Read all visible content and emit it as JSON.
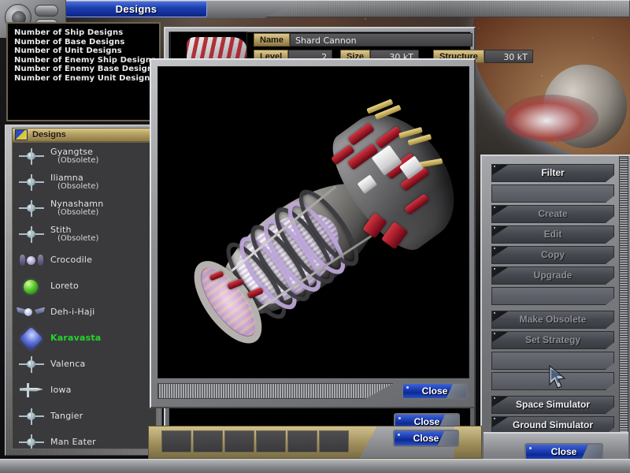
{
  "window": {
    "tab_label": "Designs",
    "icons": {
      "main_knob": "system-menu-icon",
      "pill_1": "minimize-icon",
      "pill_2": "maximize-icon"
    }
  },
  "left_readout": {
    "lines": [
      "Number of Ship Designs",
      "Number of Base Designs",
      "Number of Unit Designs",
      "Number of Enemy Ship Designs",
      "Number of Enemy Base Designs",
      "Number of Enemy Unit Designs"
    ]
  },
  "designs_panel": {
    "header_label": "Designs",
    "header_icon": "shield-flag-icon",
    "scroll_down_icon": "chevron-down-icon",
    "items": [
      {
        "name": "Gyangtse",
        "sub": "(Obsolete)",
        "icon": "cross-ship-icon",
        "selected": false
      },
      {
        "name": "Iliamna",
        "sub": "(Obsolete)",
        "icon": "cross-ship-icon",
        "selected": false
      },
      {
        "name": "Nynashamn",
        "sub": "(Obsolete)",
        "icon": "cross-ship-icon",
        "selected": false
      },
      {
        "name": "Stith",
        "sub": "(Obsolete)",
        "icon": "cross-ship-icon",
        "selected": false
      },
      {
        "name": "Crocodile",
        "sub": "",
        "icon": "pod-ship-icon",
        "selected": false
      },
      {
        "name": "Loreto",
        "sub": "",
        "icon": "green-orb-icon",
        "selected": false
      },
      {
        "name": "Deh-i-Haji",
        "sub": "",
        "icon": "winged-ship-icon",
        "selected": false
      },
      {
        "name": "Karavasta",
        "sub": "",
        "icon": "diamond-ship-icon",
        "selected": true
      },
      {
        "name": "Valenca",
        "sub": "",
        "icon": "cross-ship-icon",
        "selected": false
      },
      {
        "name": "Iowa",
        "sub": "",
        "icon": "wing-ship-icon",
        "selected": false
      },
      {
        "name": "Tangier",
        "sub": "",
        "icon": "cross-ship-icon",
        "selected": false
      },
      {
        "name": "Man Eater",
        "sub": "",
        "icon": "cross-ship-icon",
        "selected": false
      }
    ]
  },
  "component_detail": {
    "thumbnail_icon": "component-thumbnail",
    "fields": {
      "name_label": "Name",
      "name_value": "Shard Cannon",
      "level_label": "Level",
      "level_value": "2",
      "size_label": "Size",
      "size_value": "30 kT",
      "structure_label": "Structure",
      "structure_value": "30 kT"
    },
    "close_label": "Close"
  },
  "viewer": {
    "close_label": "Close",
    "grip_icon": "ribbed-grip-handle",
    "model_name": "Shard Cannon"
  },
  "commands": {
    "buttons": [
      {
        "label": "Filter",
        "state": "enabled",
        "blank": false
      },
      {
        "label": "",
        "state": "blank",
        "blank": true
      },
      {
        "label": "Create",
        "state": "disabled",
        "blank": false
      },
      {
        "label": "Edit",
        "state": "disabled",
        "blank": false
      },
      {
        "label": "Copy",
        "state": "disabled",
        "blank": false
      },
      {
        "label": "Upgrade",
        "state": "disabled",
        "blank": false
      },
      {
        "label": "",
        "state": "blank",
        "blank": true
      },
      {
        "label": "Make Obsolete",
        "state": "disabled",
        "blank": false
      },
      {
        "label": "Set Strategy",
        "state": "disabled",
        "blank": false
      },
      {
        "label": "",
        "state": "blank",
        "blank": true
      },
      {
        "label": "",
        "state": "blank",
        "blank": true
      },
      {
        "label": "Space Simulator",
        "state": "enabled",
        "blank": false
      },
      {
        "label": "Ground Simulator",
        "state": "enabled",
        "blank": false
      }
    ],
    "close_label": "Close",
    "grip_icon": "ribbed-grip-handle"
  },
  "bottom_dock": {
    "close_label": "Close",
    "slot_count": 6
  },
  "colors": {
    "accent_blue": "#1c3fb4",
    "selected_green": "#22d62c",
    "panel_gold": "#b09a5d",
    "metal_gray": "#8e9093",
    "disabled_text": "#8c8f95"
  },
  "cursor": {
    "icon": "mouse-pointer-icon"
  }
}
